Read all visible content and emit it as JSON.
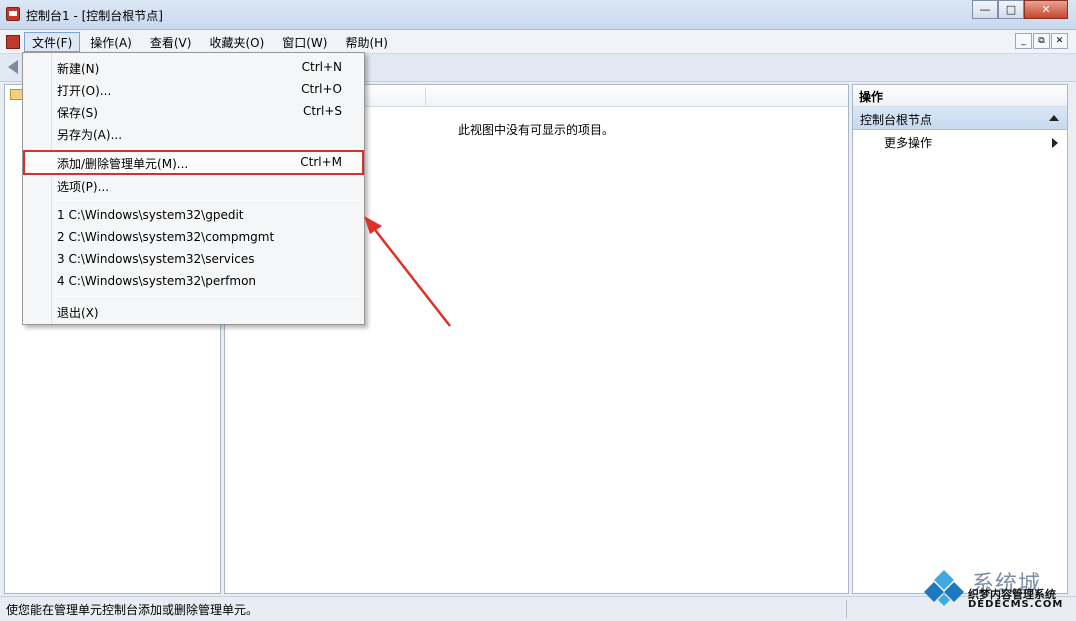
{
  "window": {
    "title": "控制台1 - [控制台根节点]",
    "controls": {
      "minimize": "—",
      "maximize": "□",
      "close": "✕"
    }
  },
  "menubar": {
    "items": [
      "文件(F)",
      "操作(A)",
      "查看(V)",
      "收藏夹(O)",
      "窗口(W)",
      "帮助(H)"
    ],
    "active": "文件(F)",
    "mdi_controls": {
      "minimize": "_",
      "restore": "⧉",
      "close": "✕"
    }
  },
  "file_menu": {
    "items": [
      {
        "label": "新建(N)",
        "shortcut": "Ctrl+N"
      },
      {
        "label": "打开(O)...",
        "shortcut": "Ctrl+O"
      },
      {
        "label": "保存(S)",
        "shortcut": "Ctrl+S"
      },
      {
        "label": "另存为(A)...",
        "shortcut": ""
      },
      {
        "label": "添加/删除管理单元(M)...",
        "shortcut": "Ctrl+M",
        "highlighted": true
      },
      {
        "label": "选项(P)...",
        "shortcut": ""
      },
      {
        "label": "1 C:\\Windows\\system32\\gpedit",
        "shortcut": ""
      },
      {
        "label": "2 C:\\Windows\\system32\\compmgmt",
        "shortcut": ""
      },
      {
        "label": "3 C:\\Windows\\system32\\services",
        "shortcut": ""
      },
      {
        "label": "4 C:\\Windows\\system32\\perfmon",
        "shortcut": ""
      },
      {
        "label": "退出(X)",
        "shortcut": ""
      }
    ]
  },
  "center": {
    "empty_message": "此视图中没有可显示的项目。"
  },
  "actions_pane": {
    "header": "操作",
    "section": "控制台根节点",
    "more_actions": "更多操作"
  },
  "statusbar": {
    "text": "使您能在管理单元控制台添加或删除管理单元。"
  },
  "watermark": {
    "line1": "系统城",
    "line2": "织梦内容管理系统",
    "line3": "DEDECMS.COM"
  },
  "colors": {
    "highlight_border": "#d9302e",
    "arrow": "#e0302a",
    "section_bg": "#c7d9ef"
  }
}
